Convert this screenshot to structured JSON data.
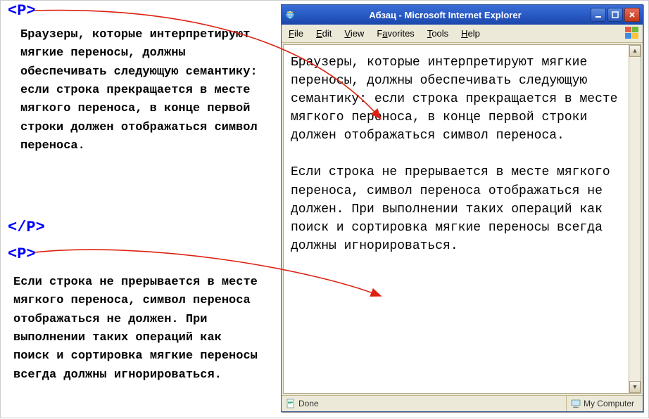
{
  "code": {
    "open_tag": "<P>",
    "close_tag": "</P>",
    "para1": "Браузеры, которые интерпретируют мягкие переносы, должны обеспечивать следующую семантику: если строка прекращается в месте мягкого переноса, в конце первой строки должен отображаться символ переноса.",
    "para2": "Если строка не прерывается в месте мягкого переноса, символ переноса отображаться не должен. При выполнении таких операций как поиск и сортировка мягкие переносы всегда должны игнорироваться."
  },
  "window": {
    "title": "Абзац - Microsoft Internet Explorer"
  },
  "menu": {
    "file": "File",
    "edit": "Edit",
    "view": "View",
    "favorites": "Favorites",
    "tools": "Tools",
    "help": "Help"
  },
  "content": {
    "para1": "Браузеры, которые интерпретируют мягкие переносы, должны обеспечивать следующую семантику: если строка прекращается в месте мягкого переноса, в конце первой строки должен отображаться символ переноса.",
    "para2": "Если строка не прерывается в месте мягкого переноса, символ переноса отображаться не должен. При выполнении таких операций как поиск и сортировка мягкие переносы всегда должны игнорироваться."
  },
  "status": {
    "done": "Done",
    "zone": "My Computer"
  }
}
